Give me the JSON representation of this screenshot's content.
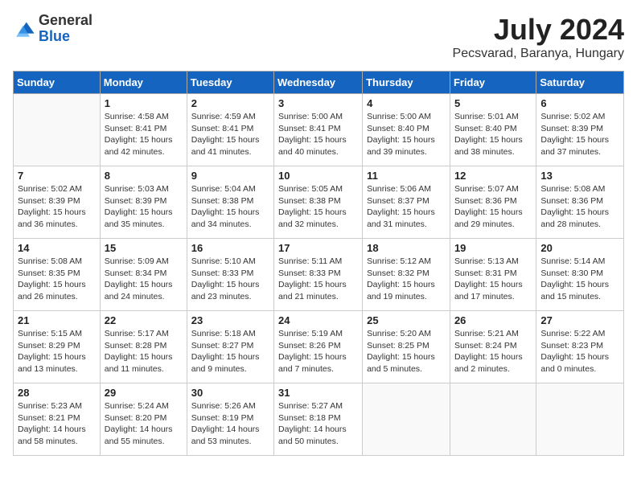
{
  "header": {
    "logo_general": "General",
    "logo_blue": "Blue",
    "month_title": "July 2024",
    "location": "Pecsvarad, Baranya, Hungary"
  },
  "columns": [
    "Sunday",
    "Monday",
    "Tuesday",
    "Wednesday",
    "Thursday",
    "Friday",
    "Saturday"
  ],
  "weeks": [
    [
      {
        "day": "",
        "info": ""
      },
      {
        "day": "1",
        "info": "Sunrise: 4:58 AM\nSunset: 8:41 PM\nDaylight: 15 hours\nand 42 minutes."
      },
      {
        "day": "2",
        "info": "Sunrise: 4:59 AM\nSunset: 8:41 PM\nDaylight: 15 hours\nand 41 minutes."
      },
      {
        "day": "3",
        "info": "Sunrise: 5:00 AM\nSunset: 8:41 PM\nDaylight: 15 hours\nand 40 minutes."
      },
      {
        "day": "4",
        "info": "Sunrise: 5:00 AM\nSunset: 8:40 PM\nDaylight: 15 hours\nand 39 minutes."
      },
      {
        "day": "5",
        "info": "Sunrise: 5:01 AM\nSunset: 8:40 PM\nDaylight: 15 hours\nand 38 minutes."
      },
      {
        "day": "6",
        "info": "Sunrise: 5:02 AM\nSunset: 8:39 PM\nDaylight: 15 hours\nand 37 minutes."
      }
    ],
    [
      {
        "day": "7",
        "info": "Sunrise: 5:02 AM\nSunset: 8:39 PM\nDaylight: 15 hours\nand 36 minutes."
      },
      {
        "day": "8",
        "info": "Sunrise: 5:03 AM\nSunset: 8:39 PM\nDaylight: 15 hours\nand 35 minutes."
      },
      {
        "day": "9",
        "info": "Sunrise: 5:04 AM\nSunset: 8:38 PM\nDaylight: 15 hours\nand 34 minutes."
      },
      {
        "day": "10",
        "info": "Sunrise: 5:05 AM\nSunset: 8:38 PM\nDaylight: 15 hours\nand 32 minutes."
      },
      {
        "day": "11",
        "info": "Sunrise: 5:06 AM\nSunset: 8:37 PM\nDaylight: 15 hours\nand 31 minutes."
      },
      {
        "day": "12",
        "info": "Sunrise: 5:07 AM\nSunset: 8:36 PM\nDaylight: 15 hours\nand 29 minutes."
      },
      {
        "day": "13",
        "info": "Sunrise: 5:08 AM\nSunset: 8:36 PM\nDaylight: 15 hours\nand 28 minutes."
      }
    ],
    [
      {
        "day": "14",
        "info": "Sunrise: 5:08 AM\nSunset: 8:35 PM\nDaylight: 15 hours\nand 26 minutes."
      },
      {
        "day": "15",
        "info": "Sunrise: 5:09 AM\nSunset: 8:34 PM\nDaylight: 15 hours\nand 24 minutes."
      },
      {
        "day": "16",
        "info": "Sunrise: 5:10 AM\nSunset: 8:33 PM\nDaylight: 15 hours\nand 23 minutes."
      },
      {
        "day": "17",
        "info": "Sunrise: 5:11 AM\nSunset: 8:33 PM\nDaylight: 15 hours\nand 21 minutes."
      },
      {
        "day": "18",
        "info": "Sunrise: 5:12 AM\nSunset: 8:32 PM\nDaylight: 15 hours\nand 19 minutes."
      },
      {
        "day": "19",
        "info": "Sunrise: 5:13 AM\nSunset: 8:31 PM\nDaylight: 15 hours\nand 17 minutes."
      },
      {
        "day": "20",
        "info": "Sunrise: 5:14 AM\nSunset: 8:30 PM\nDaylight: 15 hours\nand 15 minutes."
      }
    ],
    [
      {
        "day": "21",
        "info": "Sunrise: 5:15 AM\nSunset: 8:29 PM\nDaylight: 15 hours\nand 13 minutes."
      },
      {
        "day": "22",
        "info": "Sunrise: 5:17 AM\nSunset: 8:28 PM\nDaylight: 15 hours\nand 11 minutes."
      },
      {
        "day": "23",
        "info": "Sunrise: 5:18 AM\nSunset: 8:27 PM\nDaylight: 15 hours\nand 9 minutes."
      },
      {
        "day": "24",
        "info": "Sunrise: 5:19 AM\nSunset: 8:26 PM\nDaylight: 15 hours\nand 7 minutes."
      },
      {
        "day": "25",
        "info": "Sunrise: 5:20 AM\nSunset: 8:25 PM\nDaylight: 15 hours\nand 5 minutes."
      },
      {
        "day": "26",
        "info": "Sunrise: 5:21 AM\nSunset: 8:24 PM\nDaylight: 15 hours\nand 2 minutes."
      },
      {
        "day": "27",
        "info": "Sunrise: 5:22 AM\nSunset: 8:23 PM\nDaylight: 15 hours\nand 0 minutes."
      }
    ],
    [
      {
        "day": "28",
        "info": "Sunrise: 5:23 AM\nSunset: 8:21 PM\nDaylight: 14 hours\nand 58 minutes."
      },
      {
        "day": "29",
        "info": "Sunrise: 5:24 AM\nSunset: 8:20 PM\nDaylight: 14 hours\nand 55 minutes."
      },
      {
        "day": "30",
        "info": "Sunrise: 5:26 AM\nSunset: 8:19 PM\nDaylight: 14 hours\nand 53 minutes."
      },
      {
        "day": "31",
        "info": "Sunrise: 5:27 AM\nSunset: 8:18 PM\nDaylight: 14 hours\nand 50 minutes."
      },
      {
        "day": "",
        "info": ""
      },
      {
        "day": "",
        "info": ""
      },
      {
        "day": "",
        "info": ""
      }
    ]
  ]
}
